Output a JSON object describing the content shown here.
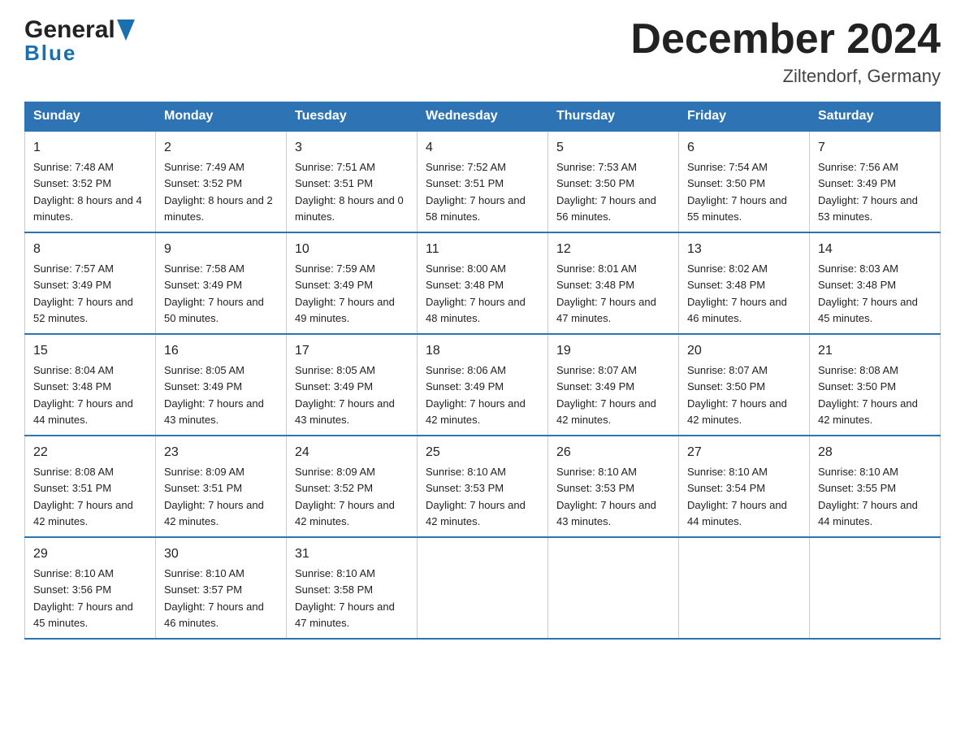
{
  "header": {
    "title": "December 2024",
    "subtitle": "Ziltendorf, Germany",
    "logo_general": "General",
    "logo_blue": "Blue"
  },
  "columns": [
    "Sunday",
    "Monday",
    "Tuesday",
    "Wednesday",
    "Thursday",
    "Friday",
    "Saturday"
  ],
  "weeks": [
    [
      {
        "day": "1",
        "sunrise": "7:48 AM",
        "sunset": "3:52 PM",
        "daylight": "8 hours and 4 minutes."
      },
      {
        "day": "2",
        "sunrise": "7:49 AM",
        "sunset": "3:52 PM",
        "daylight": "8 hours and 2 minutes."
      },
      {
        "day": "3",
        "sunrise": "7:51 AM",
        "sunset": "3:51 PM",
        "daylight": "8 hours and 0 minutes."
      },
      {
        "day": "4",
        "sunrise": "7:52 AM",
        "sunset": "3:51 PM",
        "daylight": "7 hours and 58 minutes."
      },
      {
        "day": "5",
        "sunrise": "7:53 AM",
        "sunset": "3:50 PM",
        "daylight": "7 hours and 56 minutes."
      },
      {
        "day": "6",
        "sunrise": "7:54 AM",
        "sunset": "3:50 PM",
        "daylight": "7 hours and 55 minutes."
      },
      {
        "day": "7",
        "sunrise": "7:56 AM",
        "sunset": "3:49 PM",
        "daylight": "7 hours and 53 minutes."
      }
    ],
    [
      {
        "day": "8",
        "sunrise": "7:57 AM",
        "sunset": "3:49 PM",
        "daylight": "7 hours and 52 minutes."
      },
      {
        "day": "9",
        "sunrise": "7:58 AM",
        "sunset": "3:49 PM",
        "daylight": "7 hours and 50 minutes."
      },
      {
        "day": "10",
        "sunrise": "7:59 AM",
        "sunset": "3:49 PM",
        "daylight": "7 hours and 49 minutes."
      },
      {
        "day": "11",
        "sunrise": "8:00 AM",
        "sunset": "3:48 PM",
        "daylight": "7 hours and 48 minutes."
      },
      {
        "day": "12",
        "sunrise": "8:01 AM",
        "sunset": "3:48 PM",
        "daylight": "7 hours and 47 minutes."
      },
      {
        "day": "13",
        "sunrise": "8:02 AM",
        "sunset": "3:48 PM",
        "daylight": "7 hours and 46 minutes."
      },
      {
        "day": "14",
        "sunrise": "8:03 AM",
        "sunset": "3:48 PM",
        "daylight": "7 hours and 45 minutes."
      }
    ],
    [
      {
        "day": "15",
        "sunrise": "8:04 AM",
        "sunset": "3:48 PM",
        "daylight": "7 hours and 44 minutes."
      },
      {
        "day": "16",
        "sunrise": "8:05 AM",
        "sunset": "3:49 PM",
        "daylight": "7 hours and 43 minutes."
      },
      {
        "day": "17",
        "sunrise": "8:05 AM",
        "sunset": "3:49 PM",
        "daylight": "7 hours and 43 minutes."
      },
      {
        "day": "18",
        "sunrise": "8:06 AM",
        "sunset": "3:49 PM",
        "daylight": "7 hours and 42 minutes."
      },
      {
        "day": "19",
        "sunrise": "8:07 AM",
        "sunset": "3:49 PM",
        "daylight": "7 hours and 42 minutes."
      },
      {
        "day": "20",
        "sunrise": "8:07 AM",
        "sunset": "3:50 PM",
        "daylight": "7 hours and 42 minutes."
      },
      {
        "day": "21",
        "sunrise": "8:08 AM",
        "sunset": "3:50 PM",
        "daylight": "7 hours and 42 minutes."
      }
    ],
    [
      {
        "day": "22",
        "sunrise": "8:08 AM",
        "sunset": "3:51 PM",
        "daylight": "7 hours and 42 minutes."
      },
      {
        "day": "23",
        "sunrise": "8:09 AM",
        "sunset": "3:51 PM",
        "daylight": "7 hours and 42 minutes."
      },
      {
        "day": "24",
        "sunrise": "8:09 AM",
        "sunset": "3:52 PM",
        "daylight": "7 hours and 42 minutes."
      },
      {
        "day": "25",
        "sunrise": "8:10 AM",
        "sunset": "3:53 PM",
        "daylight": "7 hours and 42 minutes."
      },
      {
        "day": "26",
        "sunrise": "8:10 AM",
        "sunset": "3:53 PM",
        "daylight": "7 hours and 43 minutes."
      },
      {
        "day": "27",
        "sunrise": "8:10 AM",
        "sunset": "3:54 PM",
        "daylight": "7 hours and 44 minutes."
      },
      {
        "day": "28",
        "sunrise": "8:10 AM",
        "sunset": "3:55 PM",
        "daylight": "7 hours and 44 minutes."
      }
    ],
    [
      {
        "day": "29",
        "sunrise": "8:10 AM",
        "sunset": "3:56 PM",
        "daylight": "7 hours and 45 minutes."
      },
      {
        "day": "30",
        "sunrise": "8:10 AM",
        "sunset": "3:57 PM",
        "daylight": "7 hours and 46 minutes."
      },
      {
        "day": "31",
        "sunrise": "8:10 AM",
        "sunset": "3:58 PM",
        "daylight": "7 hours and 47 minutes."
      },
      null,
      null,
      null,
      null
    ]
  ]
}
